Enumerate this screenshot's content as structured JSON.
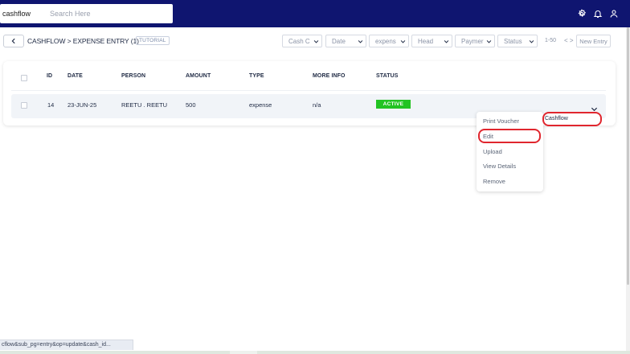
{
  "header": {
    "brand": "cashflow",
    "search_placeholder": "Search Here",
    "icons": [
      "settings-icon",
      "bell-icon",
      "user-icon"
    ]
  },
  "page": {
    "breadcrumb": "CASHFLOW > EXPENSE ENTRY (1)",
    "tutorial_label": "TUTORIAL"
  },
  "filters": {
    "cash_category": "Cash C",
    "date": "Date",
    "type": "expens",
    "head": "Head",
    "payment": "Paymer",
    "status": "Status",
    "range": "1-50",
    "pager_arrows": "< >",
    "new_entry": "New Entry"
  },
  "table": {
    "columns": [
      "ID",
      "DATE",
      "PERSON",
      "AMOUNT",
      "TYPE",
      "MORE INFO",
      "STATUS"
    ],
    "rows": [
      {
        "id": "14",
        "date": "23-JUN-25",
        "person": "REETU . REETU",
        "amount": "500",
        "type": "expense",
        "more_info": "n/a",
        "status": "ACTIVE"
      }
    ]
  },
  "action_menu": {
    "items": [
      "Print Voucher",
      "Edit",
      "Upload",
      "View Details",
      "Remove"
    ],
    "highlighted": "Edit"
  },
  "tooltip": {
    "text": "Cashflow"
  },
  "status_url": "cflow&sub_pg=entry&op=update&cash_id...",
  "colors": {
    "nav_bg": "#0f1570",
    "active_badge": "#22c322",
    "annotation_red": "#e0262e"
  }
}
